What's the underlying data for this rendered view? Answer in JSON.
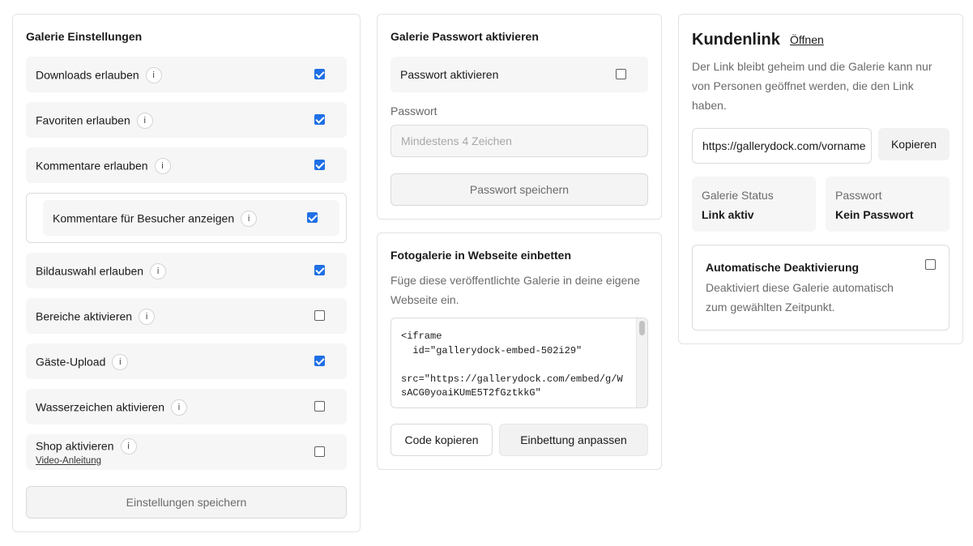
{
  "settings": {
    "title": "Galerie Einstellungen",
    "rows": [
      {
        "label": "Downloads erlauben",
        "info": "i",
        "checked": true
      },
      {
        "label": "Favoriten erlauben",
        "info": "i",
        "checked": true
      },
      {
        "label": "Kommentare erlauben",
        "info": "i",
        "checked": true
      },
      {
        "label": "Bildauswahl erlauben",
        "info": "i",
        "checked": true
      },
      {
        "label": "Bereiche aktivieren",
        "info": "i",
        "checked": false
      },
      {
        "label": "Gäste-Upload",
        "info": "i",
        "checked": true
      },
      {
        "label": "Wasserzeichen aktivieren",
        "info": "i",
        "checked": false
      },
      {
        "label": "Shop aktivieren",
        "info": "i",
        "checked": false
      }
    ],
    "sub_row": {
      "label": "Kommentare für Besucher anzeigen",
      "info": "i",
      "checked": true
    },
    "shop_video_link": "Video-Anleitung",
    "save_label": "Einstellungen speichern"
  },
  "password": {
    "title": "Galerie Passwort aktivieren",
    "toggle_label": "Passwort aktivieren",
    "toggle_checked": false,
    "field_label": "Passwort",
    "field_placeholder": "Mindestens 4 Zeichen",
    "save_label": "Passwort speichern"
  },
  "embed": {
    "title": "Fotogalerie in Webseite einbetten",
    "description": "Füge diese veröffentlichte Galerie in deine eigene Webseite ein.",
    "code": "<iframe\n  id=\"gallerydock-embed-502i29\"\n\nsrc=\"https://gallerydock.com/embed/g/W\nsACG0yoaiKUmE5T2fGztkkG\"",
    "copy_label": "Code kopieren",
    "adjust_label": "Einbettung anpassen"
  },
  "client": {
    "title": "Kundenlink",
    "open_label": "Öffnen",
    "description": "Der Link bleibt geheim und die Galerie kann nur von Personen geöffnet werden, die den Link haben.",
    "link_value": "https://gallerydock.com/vorname",
    "copy_label": "Kopieren",
    "status_key": "Galerie Status",
    "status_value": "Link aktiv",
    "password_key": "Passwort",
    "password_value": "Kein Passwort",
    "auto_title": "Automatische Deaktivierung",
    "auto_desc": "Deaktiviert diese Galerie automatisch zum gewählten Zeitpunkt.",
    "auto_checked": false
  },
  "colors": {
    "accent": "#1f6fe5"
  },
  "icons": {
    "info": "info-icon",
    "checkbox": "checkbox"
  }
}
